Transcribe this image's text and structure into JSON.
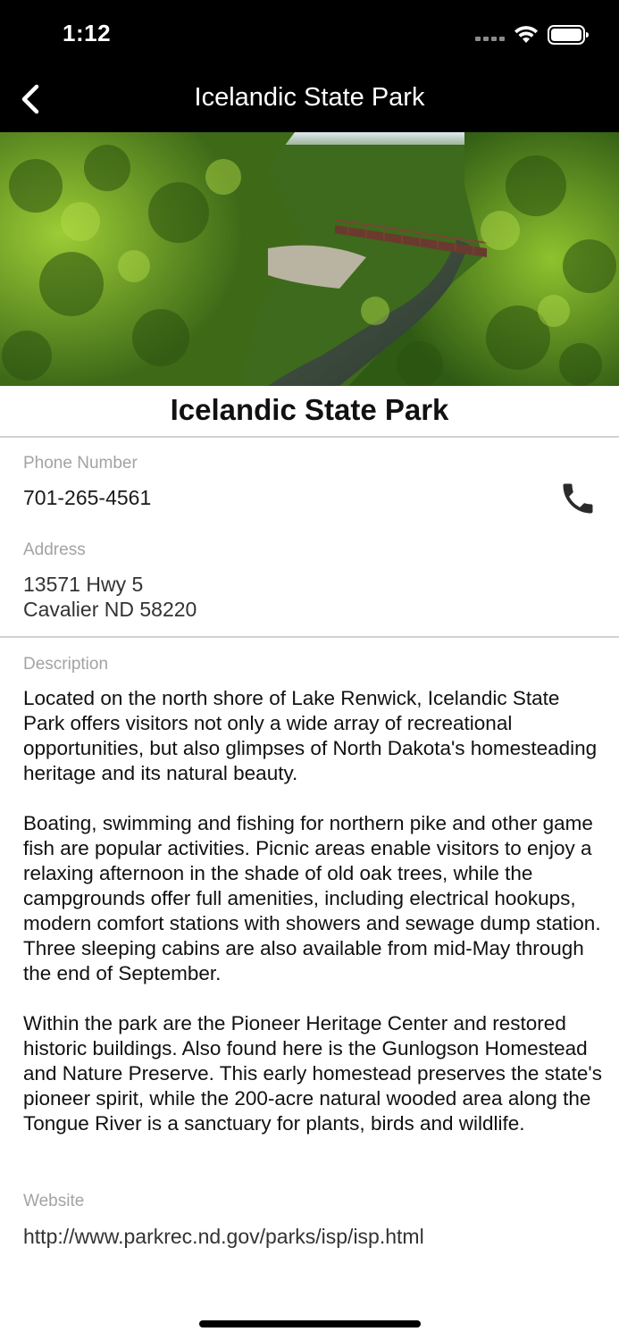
{
  "status_bar": {
    "time": "1:12"
  },
  "nav": {
    "title": "Icelandic State Park",
    "back_icon": "chevron-left-icon"
  },
  "hero": {
    "image_icon": "park-photo"
  },
  "park": {
    "name": "Icelandic State Park"
  },
  "contact": {
    "phone_label": "Phone Number",
    "phone": "701-265-4561",
    "phone_icon": "phone-icon",
    "address_label": "Address",
    "address_line1": "13571 Hwy 5",
    "address_line2": "Cavalier ND 58220"
  },
  "description": {
    "label": "Description",
    "paragraphs": [
      "Located on the north shore of Lake Renwick, Icelandic State Park offers visitors not only a wide array of recreational opportunities, but also glimpses of North Dakota's homesteading heritage and its natural beauty.",
      "Boating, swimming and fishing for northern pike and other game fish are popular activities. Picnic areas enable visitors to enjoy a relaxing afternoon in the shade of old oak trees, while the campgrounds offer full amenities, including electrical hookups, modern comfort stations with showers and sewage dump station. Three sleeping cabins are also available from mid-May through the end of September.",
      "Within the park are the Pioneer Heritage Center and restored historic buildings. Also found here is the Gunlogson Homestead and Nature Preserve. This early homestead preserves the state's pioneer spirit, while the 200-acre natural wooded area along the Tongue River is a sanctuary for plants, birds and wildlife."
    ]
  },
  "website": {
    "label": "Website",
    "url": "http://www.parkrec.nd.gov/parks/isp/isp.html"
  }
}
